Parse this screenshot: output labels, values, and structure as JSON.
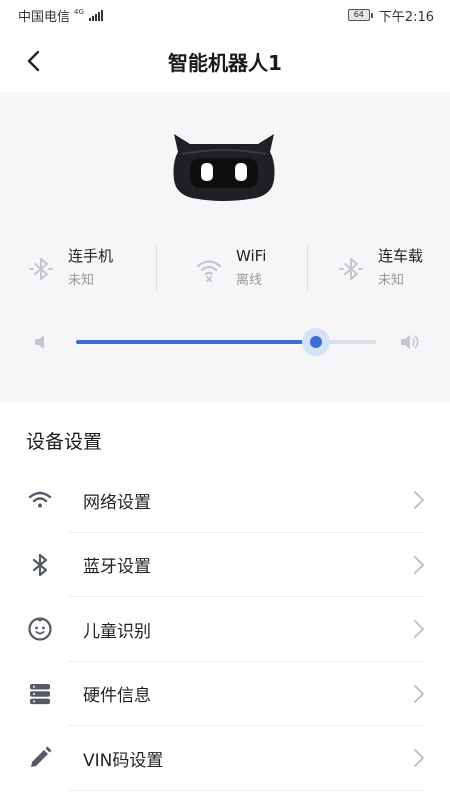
{
  "status_bar": {
    "carrier": "中国电信",
    "network": "4G",
    "battery_level": "64",
    "time": "下午2:16"
  },
  "header": {
    "title": "智能机器人1"
  },
  "device_status": {
    "items": [
      {
        "label": "连手机",
        "value": "未知",
        "icon": "bluetooth-off-icon"
      },
      {
        "label": "WiFi",
        "value": "离线",
        "icon": "wifi-off-icon"
      },
      {
        "label": "连车载",
        "value": "未知",
        "icon": "bluetooth-off-icon"
      }
    ]
  },
  "volume": {
    "level_percent": 80
  },
  "settings": {
    "section_title": "设备设置",
    "items": [
      {
        "label": "网络设置",
        "icon": "wifi-icon"
      },
      {
        "label": "蓝牙设置",
        "icon": "bluetooth-icon"
      },
      {
        "label": "儿童识别",
        "icon": "child-face-icon"
      },
      {
        "label": "硬件信息",
        "icon": "hardware-icon"
      },
      {
        "label": "VIN码设置",
        "icon": "pencil-icon"
      }
    ]
  },
  "colors": {
    "accent": "#3b6fd6",
    "panel_bg": "#f6f6f8",
    "icon_gray": "#555a66",
    "muted_icon": "#c4c6cc"
  }
}
